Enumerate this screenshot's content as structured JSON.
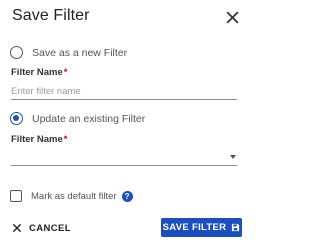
{
  "dialog": {
    "title": "Save Filter"
  },
  "options": {
    "new_filter_label": "Save as a new Filter",
    "existing_filter_label": "Update an existing Filter",
    "selected": "existing"
  },
  "new_filter": {
    "label": "Filter Name",
    "required_mark": "*",
    "value": "",
    "placeholder": "Enter filter name"
  },
  "existing_filter": {
    "label": "Filter Name",
    "required_mark": "*",
    "selected_value": ""
  },
  "default_checkbox": {
    "label": "Mark as default filter",
    "checked": false,
    "help_glyph": "?"
  },
  "buttons": {
    "cancel_label": "CANCEL",
    "save_label": "SAVE FILTER"
  },
  "colors": {
    "primary": "#1b4fbf",
    "required": "#d0021b"
  },
  "icons": {
    "close": "close-icon",
    "help": "help-icon",
    "cancel": "close-icon",
    "save": "save-icon",
    "dropdown": "chevron-down-icon"
  }
}
